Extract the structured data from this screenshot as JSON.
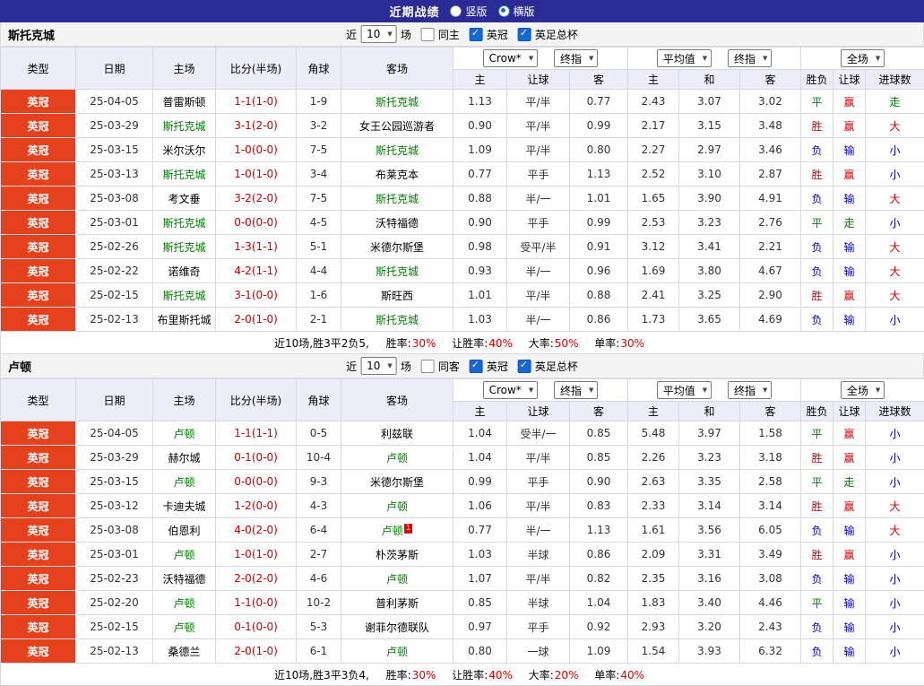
{
  "topbar": {
    "title": "近期战绩",
    "radios": [
      {
        "label": "竖版",
        "checked": false
      },
      {
        "label": "横版",
        "checked": true
      }
    ]
  },
  "icons": {
    "caret": "▼"
  },
  "controls": {
    "odds_company": "Crow*",
    "odds_final": "终指",
    "average": "平均值",
    "average_final": "终指",
    "scope": "全场"
  },
  "columns": {
    "type": "类型",
    "date": "日期",
    "home": "主场",
    "score": "比分(半场)",
    "corner": "角球",
    "away": "客场",
    "odds_home": "主",
    "odds_line": "让球",
    "odds_away": "客",
    "avg_home": "主",
    "avg_draw": "和",
    "avg_away": "客",
    "result": "胜负",
    "result_handicap": "让球",
    "result_goals": "进球数"
  },
  "colors": {
    "red": "#d40000",
    "green": "#008000",
    "blue": "#0000cc",
    "league_bg": "#e5411c",
    "self_team": "#008000",
    "score": "#c80000",
    "topbar_bg": "#2b2b96",
    "check_blue": "#1667d9"
  },
  "sections": [
    {
      "team": "斯托克城",
      "filter": {
        "near": "近",
        "count": "10",
        "games": "场",
        "same": "同主",
        "same_checked": false,
        "league": "英冠",
        "league_checked": true,
        "cup": "英足总杯",
        "cup_checked": true
      },
      "rows": [
        {
          "type": "英冠",
          "date": "25-04-05",
          "home": "普雷斯顿",
          "home_self": false,
          "score": "1-1(1-0)",
          "corner": "1-9",
          "away": "斯托克城",
          "away_self": true,
          "odds_home": "1.13",
          "line": "平/半",
          "odds_away": "0.77",
          "avg_home": "2.43",
          "avg_draw": "3.07",
          "avg_away": "3.02",
          "result": "平",
          "handicap_result": "赢",
          "goals_result": "走"
        },
        {
          "type": "英冠",
          "date": "25-03-29",
          "home": "斯托克城",
          "home_self": true,
          "score": "3-1(2-0)",
          "corner": "3-2",
          "away": "女王公园巡游者",
          "away_self": false,
          "odds_home": "0.90",
          "line": "平/半",
          "odds_away": "0.99",
          "avg_home": "2.17",
          "avg_draw": "3.15",
          "avg_away": "3.48",
          "result": "胜",
          "handicap_result": "赢",
          "goals_result": "大"
        },
        {
          "type": "英冠",
          "date": "25-03-15",
          "home": "米尔沃尔",
          "home_self": false,
          "score": "1-0(0-0)",
          "corner": "7-5",
          "away": "斯托克城",
          "away_self": true,
          "odds_home": "1.09",
          "line": "平/半",
          "odds_away": "0.80",
          "avg_home": "2.27",
          "avg_draw": "2.97",
          "avg_away": "3.46",
          "result": "负",
          "handicap_result": "输",
          "goals_result": "小"
        },
        {
          "type": "英冠",
          "date": "25-03-13",
          "home": "斯托克城",
          "home_self": true,
          "score": "1-0(1-0)",
          "corner": "3-4",
          "away": "布莱克本",
          "away_self": false,
          "odds_home": "0.77",
          "line": "平手",
          "odds_away": "1.13",
          "avg_home": "2.52",
          "avg_draw": "3.10",
          "avg_away": "2.87",
          "result": "胜",
          "handicap_result": "赢",
          "goals_result": "小"
        },
        {
          "type": "英冠",
          "date": "25-03-08",
          "home": "考文垂",
          "home_self": false,
          "score": "3-2(2-0)",
          "corner": "7-5",
          "away": "斯托克城",
          "away_self": true,
          "odds_home": "0.88",
          "line": "半/一",
          "odds_away": "1.01",
          "avg_home": "1.65",
          "avg_draw": "3.90",
          "avg_away": "4.91",
          "result": "负",
          "handicap_result": "输",
          "goals_result": "大"
        },
        {
          "type": "英冠",
          "date": "25-03-01",
          "home": "斯托克城",
          "home_self": true,
          "score": "0-0(0-0)",
          "corner": "4-5",
          "away": "沃特福德",
          "away_self": false,
          "odds_home": "0.90",
          "line": "平手",
          "odds_away": "0.99",
          "avg_home": "2.53",
          "avg_draw": "3.23",
          "avg_away": "2.76",
          "result": "平",
          "handicap_result": "走",
          "goals_result": "小"
        },
        {
          "type": "英冠",
          "date": "25-02-26",
          "home": "斯托克城",
          "home_self": true,
          "score": "1-3(1-1)",
          "corner": "5-1",
          "away": "米德尔斯堡",
          "away_self": false,
          "odds_home": "0.98",
          "line": "受平/半",
          "odds_away": "0.91",
          "avg_home": "3.12",
          "avg_draw": "3.41",
          "avg_away": "2.21",
          "result": "负",
          "handicap_result": "输",
          "goals_result": "大"
        },
        {
          "type": "英冠",
          "date": "25-02-22",
          "home": "诺维奇",
          "home_self": false,
          "score": "4-2(1-1)",
          "corner": "4-4",
          "away": "斯托克城",
          "away_self": true,
          "odds_home": "0.93",
          "line": "半/一",
          "odds_away": "0.96",
          "avg_home": "1.69",
          "avg_draw": "3.80",
          "avg_away": "4.67",
          "result": "负",
          "handicap_result": "输",
          "goals_result": "大"
        },
        {
          "type": "英冠",
          "date": "25-02-15",
          "home": "斯托克城",
          "home_self": true,
          "score": "3-1(0-0)",
          "corner": "1-6",
          "away": "斯旺西",
          "away_self": false,
          "odds_home": "1.01",
          "line": "平/半",
          "odds_away": "0.88",
          "avg_home": "2.41",
          "avg_draw": "3.25",
          "avg_away": "2.90",
          "result": "胜",
          "handicap_result": "赢",
          "goals_result": "大"
        },
        {
          "type": "英冠",
          "date": "25-02-13",
          "home": "布里斯托城",
          "home_self": false,
          "score": "2-0(1-0)",
          "corner": "2-1",
          "away": "斯托克城",
          "away_self": true,
          "odds_home": "1.03",
          "line": "半/一",
          "odds_away": "0.86",
          "avg_home": "1.73",
          "avg_draw": "3.65",
          "avg_away": "4.69",
          "result": "负",
          "handicap_result": "输",
          "goals_result": "小"
        }
      ],
      "summary": {
        "prefix": "近10场,胜3平2负5,",
        "stats": [
          {
            "label": "胜率:",
            "value": "30%"
          },
          {
            "label": "让胜率:",
            "value": "40%"
          },
          {
            "label": "大率:",
            "value": "50%"
          },
          {
            "label": "单率:",
            "value": "30%"
          }
        ]
      }
    },
    {
      "team": "卢顿",
      "filter": {
        "near": "近",
        "count": "10",
        "games": "场",
        "same": "同客",
        "same_checked": false,
        "league": "英冠",
        "league_checked": true,
        "cup": "英足总杯",
        "cup_checked": true
      },
      "rows": [
        {
          "type": "英冠",
          "date": "25-04-05",
          "home": "卢顿",
          "home_self": true,
          "score": "1-1(1-1)",
          "corner": "0-5",
          "away": "利兹联",
          "away_self": false,
          "odds_home": "1.04",
          "line": "受半/一",
          "odds_away": "0.85",
          "avg_home": "5.48",
          "avg_draw": "3.97",
          "avg_away": "1.58",
          "result": "平",
          "handicap_result": "赢",
          "goals_result": "小"
        },
        {
          "type": "英冠",
          "date": "25-03-29",
          "home": "赫尔城",
          "home_self": false,
          "score": "0-1(0-0)",
          "corner": "10-4",
          "away": "卢顿",
          "away_self": true,
          "odds_home": "1.04",
          "line": "平/半",
          "odds_away": "0.85",
          "avg_home": "2.26",
          "avg_draw": "3.23",
          "avg_away": "3.18",
          "result": "胜",
          "handicap_result": "赢",
          "goals_result": "小"
        },
        {
          "type": "英冠",
          "date": "25-03-15",
          "home": "卢顿",
          "home_self": true,
          "score": "0-0(0-0)",
          "corner": "9-3",
          "away": "米德尔斯堡",
          "away_self": false,
          "odds_home": "0.99",
          "line": "平手",
          "odds_away": "0.90",
          "avg_home": "2.63",
          "avg_draw": "3.35",
          "avg_away": "2.58",
          "result": "平",
          "handicap_result": "走",
          "goals_result": "小"
        },
        {
          "type": "英冠",
          "date": "25-03-12",
          "home": "卡迪夫城",
          "home_self": false,
          "score": "1-2(0-0)",
          "corner": "4-3",
          "away": "卢顿",
          "away_self": true,
          "odds_home": "1.06",
          "line": "平/半",
          "odds_away": "0.83",
          "avg_home": "2.33",
          "avg_draw": "3.14",
          "avg_away": "3.14",
          "result": "胜",
          "handicap_result": "赢",
          "goals_result": "大"
        },
        {
          "type": "英冠",
          "date": "25-03-08",
          "home": "伯恩利",
          "home_self": false,
          "score": "4-0(2-0)",
          "corner": "6-4",
          "away": "卢顿",
          "away_self": true,
          "away_badge": "1",
          "odds_home": "0.77",
          "line": "半/一",
          "odds_away": "1.13",
          "avg_home": "1.61",
          "avg_draw": "3.56",
          "avg_away": "6.05",
          "result": "负",
          "handicap_result": "输",
          "goals_result": "大"
        },
        {
          "type": "英冠",
          "date": "25-03-01",
          "home": "卢顿",
          "home_self": true,
          "score": "1-0(1-0)",
          "corner": "2-7",
          "away": "朴茨茅斯",
          "away_self": false,
          "odds_home": "1.03",
          "line": "半球",
          "odds_away": "0.86",
          "avg_home": "2.09",
          "avg_draw": "3.31",
          "avg_away": "3.49",
          "result": "胜",
          "handicap_result": "赢",
          "goals_result": "小"
        },
        {
          "type": "英冠",
          "date": "25-02-23",
          "home": "沃特福德",
          "home_self": false,
          "score": "2-0(2-0)",
          "corner": "4-6",
          "away": "卢顿",
          "away_self": true,
          "odds_home": "1.07",
          "line": "平/半",
          "odds_away": "0.82",
          "avg_home": "2.35",
          "avg_draw": "3.16",
          "avg_away": "3.08",
          "result": "负",
          "handicap_result": "输",
          "goals_result": "小"
        },
        {
          "type": "英冠",
          "date": "25-02-20",
          "home": "卢顿",
          "home_self": true,
          "score": "1-1(0-0)",
          "corner": "10-2",
          "away": "普利茅斯",
          "away_self": false,
          "odds_home": "0.85",
          "line": "半球",
          "odds_away": "1.04",
          "avg_home": "1.83",
          "avg_draw": "3.40",
          "avg_away": "4.46",
          "result": "平",
          "handicap_result": "输",
          "goals_result": "小"
        },
        {
          "type": "英冠",
          "date": "25-02-15",
          "home": "卢顿",
          "home_self": true,
          "score": "0-1(0-0)",
          "corner": "5-3",
          "away": "谢菲尔德联队",
          "away_self": false,
          "odds_home": "0.97",
          "line": "平手",
          "odds_away": "0.92",
          "avg_home": "2.93",
          "avg_draw": "3.20",
          "avg_away": "2.43",
          "result": "负",
          "handicap_result": "输",
          "goals_result": "小"
        },
        {
          "type": "英冠",
          "date": "25-02-13",
          "home": "桑德兰",
          "home_self": false,
          "score": "2-0(1-0)",
          "corner": "6-1",
          "away": "卢顿",
          "away_self": true,
          "odds_home": "0.80",
          "line": "一球",
          "odds_away": "1.09",
          "avg_home": "1.54",
          "avg_draw": "3.93",
          "avg_away": "6.32",
          "result": "负",
          "handicap_result": "输",
          "goals_result": "小"
        }
      ],
      "summary": {
        "prefix": "近10场,胜3平3负4,",
        "stats": [
          {
            "label": "胜率:",
            "value": "30%"
          },
          {
            "label": "让胜率:",
            "value": "40%"
          },
          {
            "label": "大率:",
            "value": "20%"
          },
          {
            "label": "单率:",
            "value": "40%"
          }
        ]
      }
    }
  ]
}
